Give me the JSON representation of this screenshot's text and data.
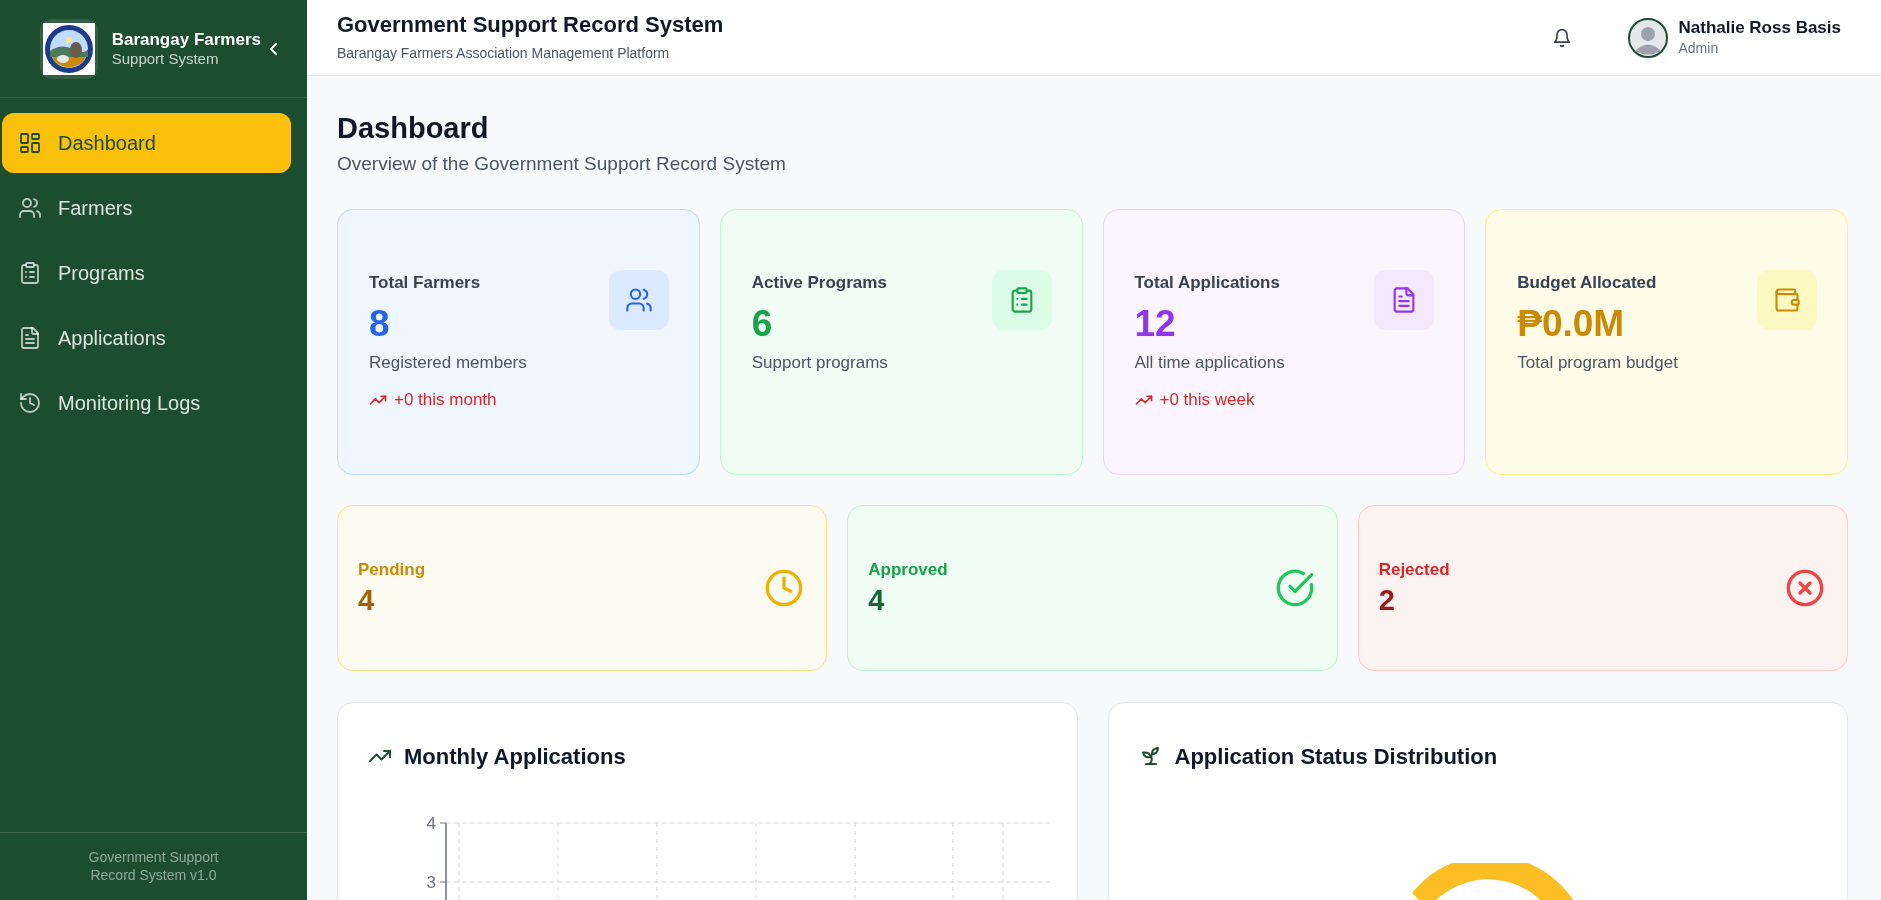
{
  "sidebar": {
    "brand_title": "Barangay Farmers",
    "brand_subtitle": "Support System",
    "items": [
      {
        "label": "Dashboard",
        "selected": true
      },
      {
        "label": "Farmers",
        "selected": false
      },
      {
        "label": "Programs",
        "selected": false
      },
      {
        "label": "Applications",
        "selected": false
      },
      {
        "label": "Monitoring Logs",
        "selected": false
      }
    ],
    "footer": [
      "Government Support",
      "Record System v1.0"
    ]
  },
  "header": {
    "title": "Government Support Record System",
    "subtitle": "Barangay Farmers Association Management Platform",
    "user_name": "Nathalie Ross Basis",
    "user_role": "Admin"
  },
  "page": {
    "title": "Dashboard",
    "subtitle": "Overview of the Government Support Record System"
  },
  "stats": [
    {
      "label": "Total Farmers",
      "value": "8",
      "note": "Registered members",
      "trend": "+0 this month",
      "kind": "farmers"
    },
    {
      "label": "Active Programs",
      "value": "6",
      "note": "Support programs",
      "kind": "programs"
    },
    {
      "label": "Total Applications",
      "value": "12",
      "note": "All time applications",
      "trend": "+0 this week",
      "kind": "applications"
    },
    {
      "label": "Budget Allocated",
      "value": "₱0.0M",
      "note": "Total program budget",
      "kind": "budget"
    }
  ],
  "statuses": [
    {
      "label": "Pending",
      "value": "4",
      "kind": "pending"
    },
    {
      "label": "Approved",
      "value": "4",
      "kind": "approved"
    },
    {
      "label": "Rejected",
      "value": "2",
      "kind": "rejected"
    }
  ],
  "charts": [
    {
      "title": "Monthly Applications",
      "kind": "grid",
      "y_axis_labels": [
        "4",
        "3"
      ]
    },
    {
      "title": "Application Status Distribution",
      "kind": "donut"
    }
  ]
}
